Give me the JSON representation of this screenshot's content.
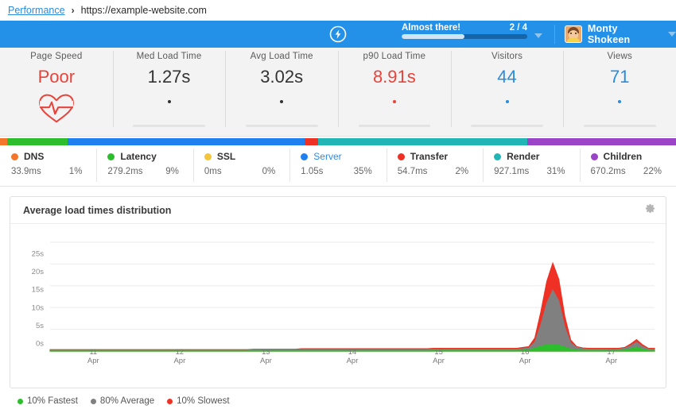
{
  "breadcrumb": {
    "root_label": "Performance",
    "separator": "›",
    "url": "https://example-website.com"
  },
  "topbar": {
    "bolt_icon": "lightning-bolt-icon",
    "progress_label": "Almost there!",
    "progress_count": "2 / 4",
    "progress_percent": 50,
    "caret_icon": "chevron-down-icon",
    "user_name": "Monty Shokeen",
    "user_caret_icon": "chevron-down-icon",
    "bg_color": "#2391e8"
  },
  "stats": [
    {
      "label": "Page Speed",
      "value": "Poor",
      "color": "#e8433b",
      "mark": "heart-pulse-icon"
    },
    {
      "label": "Med Load Time",
      "value": "1.27s",
      "color": "#333333",
      "mark": "dot"
    },
    {
      "label": "Avg Load Time",
      "value": "3.02s",
      "color": "#333333",
      "mark": "dot"
    },
    {
      "label": "p90 Load Time",
      "value": "8.91s",
      "color": "#e8433b",
      "mark": "dot"
    },
    {
      "label": "Visitors",
      "value": "44",
      "color": "#2a8cdd",
      "mark": "dot"
    },
    {
      "label": "Views",
      "value": "71",
      "color": "#2a8cdd",
      "mark": "dot"
    }
  ],
  "breakdown": [
    {
      "name": "DNS",
      "time": "33.9ms",
      "percent": "1%",
      "pct": 1,
      "color": "#f4762a",
      "active": false
    },
    {
      "name": "Latency",
      "time": "279.2ms",
      "percent": "9%",
      "pct": 9,
      "color": "#2dbe2d",
      "active": false
    },
    {
      "name": "SSL",
      "time": "0ms",
      "percent": "0%",
      "pct": 0,
      "color": "#f3c53b",
      "active": false
    },
    {
      "name": "Server",
      "time": "1.05s",
      "percent": "35%",
      "pct": 35,
      "color": "#2080f0",
      "active": true
    },
    {
      "name": "Transfer",
      "time": "54.7ms",
      "percent": "2%",
      "pct": 2,
      "color": "#ee3124",
      "active": false
    },
    {
      "name": "Render",
      "time": "927.1ms",
      "percent": "31%",
      "pct": 31,
      "color": "#21b5b5",
      "active": false
    },
    {
      "name": "Children",
      "time": "670.2ms",
      "percent": "22%",
      "pct": 22,
      "color": "#9c44c8",
      "active": false
    }
  ],
  "panel": {
    "title": "Average load times distribution",
    "settings_icon": "gear-icon"
  },
  "chart_data": {
    "type": "area",
    "title": "Average load times distribution",
    "xlabel": "",
    "ylabel": "",
    "ylim": [
      0,
      27
    ],
    "yticks": [
      "0s",
      "5s",
      "10s",
      "15s",
      "20s",
      "25s"
    ],
    "ytick_values": [
      0,
      5,
      10,
      15,
      20,
      25
    ],
    "grid": true,
    "legend_position": "bottom-left",
    "x": [
      "11 Apr",
      "12 Apr",
      "13 Apr",
      "14 Apr",
      "15 Apr",
      "16 Apr",
      "17 Apr"
    ],
    "xtick_labels": [
      {
        "day": "11",
        "month": "Apr"
      },
      {
        "day": "12",
        "month": "Apr"
      },
      {
        "day": "13",
        "month": "Apr"
      },
      {
        "day": "14",
        "month": "Apr"
      },
      {
        "day": "15",
        "month": "Apr"
      },
      {
        "day": "16",
        "month": "Apr"
      },
      {
        "day": "17",
        "month": "Apr"
      }
    ],
    "series": [
      {
        "name": "10% Slowest",
        "color": "#ee3124",
        "values": [
          0.3,
          0.3,
          0.3,
          0.3,
          0.3,
          0.3,
          0.3,
          0.3,
          0.3,
          0.3,
          0.3,
          0.3,
          0.3,
          0.3,
          0.3,
          0.3,
          0.3,
          0.3,
          0.3,
          0.3,
          0.3,
          0.3,
          0.3,
          0.3,
          0.3,
          0.3,
          0.3,
          0.3,
          0.3,
          0.3,
          0.3,
          0.3,
          0.3,
          0.3,
          0.4,
          0.4,
          0.4,
          0.4,
          0.4,
          0.4,
          0.4,
          0.4,
          0.5,
          0.5,
          0.5,
          0.5,
          0.5,
          0.5,
          0.5,
          0.5,
          0.5,
          0.5,
          0.5,
          0.5,
          0.5,
          0.5,
          0.5,
          0.5,
          0.5,
          0.5,
          0.5,
          0.5,
          0.5,
          0.5,
          0.6,
          0.6,
          0.6,
          0.6,
          0.6,
          0.6,
          0.6,
          0.6,
          0.6,
          0.6,
          0.6,
          0.6,
          0.6,
          0.6,
          0.6,
          0.8,
          1.0,
          3.0,
          9.0,
          16.0,
          20.2,
          16.5,
          8.0,
          2.5,
          1.0,
          0.7,
          0.6,
          0.6,
          0.6,
          0.6,
          0.6,
          0.6,
          0.8,
          1.6,
          2.6,
          1.4,
          0.6,
          0.6
        ]
      },
      {
        "name": "80% Average",
        "color": "#808080",
        "values": [
          0.2,
          0.2,
          0.2,
          0.2,
          0.2,
          0.2,
          0.2,
          0.2,
          0.2,
          0.2,
          0.2,
          0.2,
          0.2,
          0.2,
          0.2,
          0.2,
          0.2,
          0.2,
          0.2,
          0.2,
          0.2,
          0.2,
          0.2,
          0.2,
          0.2,
          0.2,
          0.2,
          0.2,
          0.2,
          0.2,
          0.2,
          0.2,
          0.2,
          0.2,
          0.3,
          0.3,
          0.3,
          0.3,
          0.3,
          0.3,
          0.3,
          0.3,
          0.3,
          0.3,
          0.3,
          0.3,
          0.3,
          0.3,
          0.3,
          0.3,
          0.3,
          0.3,
          0.3,
          0.3,
          0.3,
          0.3,
          0.3,
          0.3,
          0.3,
          0.3,
          0.3,
          0.3,
          0.3,
          0.3,
          0.4,
          0.4,
          0.4,
          0.4,
          0.4,
          0.4,
          0.4,
          0.4,
          0.4,
          0.4,
          0.4,
          0.4,
          0.4,
          0.4,
          0.4,
          0.5,
          0.7,
          2.0,
          6.0,
          11.0,
          14.0,
          11.5,
          5.5,
          1.8,
          0.8,
          0.5,
          0.4,
          0.4,
          0.4,
          0.4,
          0.4,
          0.4,
          0.6,
          1.2,
          2.0,
          1.0,
          0.4,
          0.4
        ]
      },
      {
        "name": "10% Fastest",
        "color": "#2dbe2d",
        "values": [
          0.1,
          0.1,
          0.1,
          0.1,
          0.1,
          0.1,
          0.1,
          0.1,
          0.1,
          0.1,
          0.1,
          0.1,
          0.1,
          0.1,
          0.1,
          0.1,
          0.1,
          0.1,
          0.1,
          0.1,
          0.1,
          0.1,
          0.1,
          0.1,
          0.1,
          0.1,
          0.1,
          0.1,
          0.1,
          0.1,
          0.1,
          0.1,
          0.1,
          0.1,
          0.1,
          0.1,
          0.1,
          0.1,
          0.1,
          0.1,
          0.1,
          0.1,
          0.1,
          0.1,
          0.1,
          0.1,
          0.1,
          0.1,
          0.1,
          0.1,
          0.1,
          0.1,
          0.1,
          0.1,
          0.1,
          0.1,
          0.1,
          0.1,
          0.1,
          0.1,
          0.1,
          0.1,
          0.1,
          0.1,
          0.15,
          0.15,
          0.15,
          0.15,
          0.15,
          0.15,
          0.15,
          0.15,
          0.15,
          0.15,
          0.15,
          0.15,
          0.15,
          0.15,
          0.15,
          0.2,
          0.3,
          0.6,
          1.1,
          1.4,
          1.5,
          1.3,
          0.9,
          0.4,
          0.2,
          0.15,
          0.15,
          0.15,
          0.15,
          0.15,
          0.15,
          0.15,
          0.2,
          0.5,
          0.9,
          0.4,
          0.15,
          0.15
        ]
      }
    ],
    "legend": [
      {
        "label": "10% Fastest",
        "color": "#2dbe2d"
      },
      {
        "label": "80% Average",
        "color": "#808080"
      },
      {
        "label": "10% Slowest",
        "color": "#ee3124"
      }
    ]
  }
}
